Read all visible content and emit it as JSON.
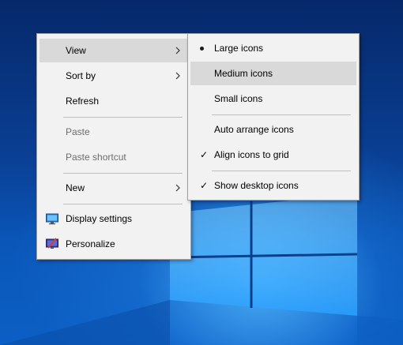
{
  "context_menu": {
    "items": [
      {
        "label": "View",
        "has_submenu": true,
        "highlighted": true
      },
      {
        "label": "Sort by",
        "has_submenu": true
      },
      {
        "label": "Refresh"
      },
      {
        "label": "Paste",
        "disabled": true
      },
      {
        "label": "Paste shortcut",
        "disabled": true
      },
      {
        "label": "New",
        "has_submenu": true
      },
      {
        "label": "Display settings",
        "icon": "display-settings-icon"
      },
      {
        "label": "Personalize",
        "icon": "personalize-icon"
      }
    ]
  },
  "view_submenu": {
    "items": [
      {
        "label": "Large icons",
        "selected": true,
        "mark": "bullet"
      },
      {
        "label": "Medium icons",
        "highlighted": true
      },
      {
        "label": "Small icons"
      },
      {
        "label": "Auto arrange icons"
      },
      {
        "label": "Align icons to grid",
        "checked": true,
        "mark": "✓"
      },
      {
        "label": "Show desktop icons",
        "checked": true,
        "mark": "✓"
      }
    ]
  },
  "colors": {
    "menu_bg": "#f2f2f2",
    "highlight": "#d9d9d9",
    "disabled_text": "#6d6d6d",
    "desktop_accent": "#0a56b8"
  }
}
